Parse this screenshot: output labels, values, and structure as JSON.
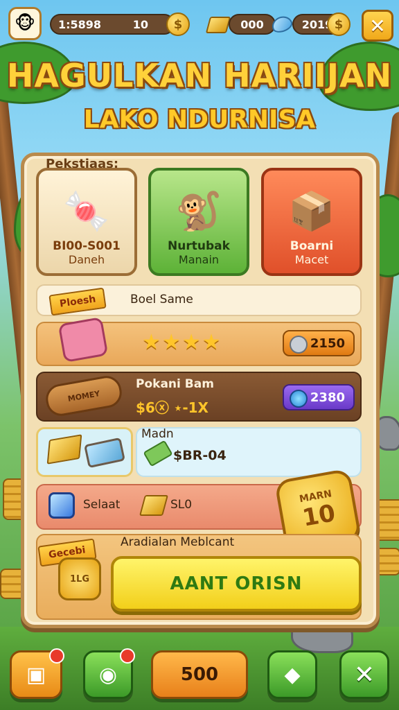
{
  "header": {
    "stat_1": "1:5898",
    "coins": "10",
    "coin_symbol": "$",
    "gold": "000",
    "gems": "2019",
    "close_symbol": "✕"
  },
  "title": {
    "main": "HAGULKAN HARIIJAN",
    "sub": "LAKO NDURNISA"
  },
  "panel": {
    "tab_label": "Pekstiaas:",
    "cards": [
      {
        "line1": "BI00-S001",
        "line2": "Daneh",
        "icon": "candy-icon"
      },
      {
        "line1": "Nurtubak",
        "line2": "Manain",
        "icon": "monkey-icon"
      },
      {
        "line1": "Boarni",
        "line2": "Macet",
        "icon": "box-icon"
      }
    ],
    "row1": {
      "banner": "Ploesh",
      "text": "Boel Same"
    },
    "row2": {
      "stars": "★★★★",
      "price": "2150"
    },
    "row3": {
      "title": "Pokani Bam",
      "subtitle": "$6ⓧ ⋆-1X",
      "price": "2380",
      "log_label": "MOMEY"
    },
    "row4": {
      "title": "Madn",
      "value": "$BR-04"
    },
    "row5": {
      "gem_text": "Selaat",
      "gold_text": "SL0"
    },
    "medal": {
      "line1": "MARN",
      "line2": "10"
    },
    "row6": {
      "banner": "Gecebi",
      "heading": "Aradialan Meblcant",
      "pouch_label": "1LG",
      "cta": "AANT ORISN"
    }
  },
  "bottom_bar": {
    "b1": "▣",
    "b2": "◉",
    "value": "500",
    "b4": "◆",
    "b5": "✕"
  }
}
